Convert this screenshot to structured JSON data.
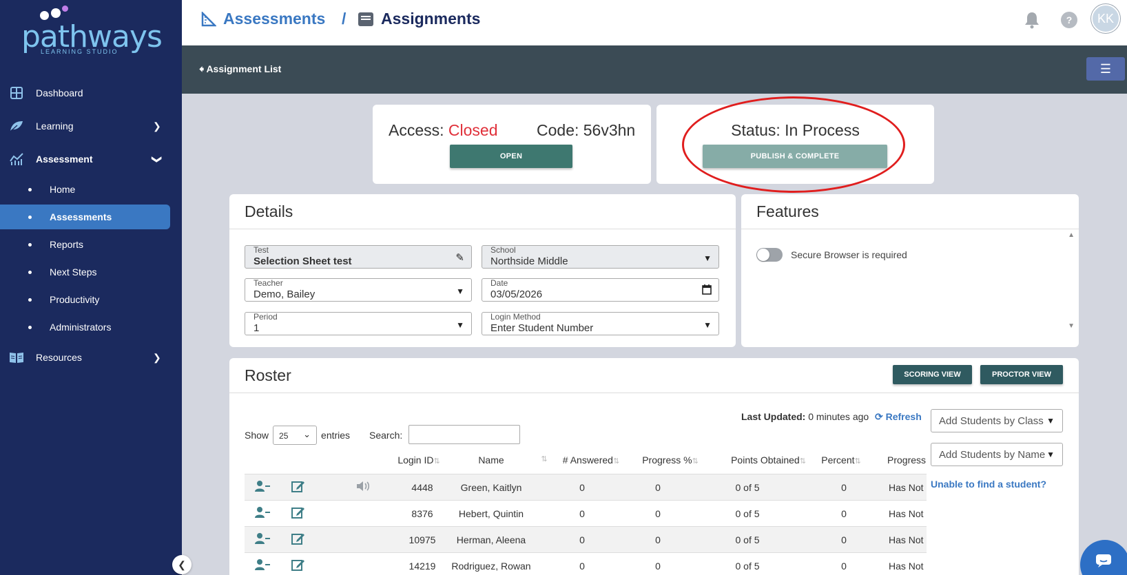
{
  "brand": {
    "word": "pathways",
    "sub": "LEARNING STUDIO"
  },
  "sidebar": {
    "items": [
      {
        "label": "Dashboard",
        "icon": "dashboard-icon"
      },
      {
        "label": "Learning",
        "icon": "leaf-icon"
      },
      {
        "label": "Assessment",
        "icon": "chart-icon"
      },
      {
        "label": "Resources",
        "icon": "book-icon"
      }
    ],
    "subitems": [
      {
        "label": "Home"
      },
      {
        "label": "Assessments",
        "active": true
      },
      {
        "label": "Reports"
      },
      {
        "label": "Next Steps"
      },
      {
        "label": "Productivity"
      },
      {
        "label": "Administrators"
      }
    ]
  },
  "header": {
    "crumb1": "Assessments",
    "separator": "/",
    "crumb2": "Assignments",
    "avatar_initials": "KK",
    "help": "?"
  },
  "subbar": {
    "back_label": "Assignment List"
  },
  "access": {
    "label": "Access:",
    "value": "Closed",
    "code_label": "Code:",
    "code_value": "56v3hn",
    "open_button": "OPEN"
  },
  "status": {
    "label": "Status:",
    "value": "In Process",
    "publish_button": "PUBLISH & COMPLETE"
  },
  "details": {
    "title": "Details",
    "test_label": "Test",
    "test_value": "Selection Sheet test",
    "school_label": "School",
    "school_value": "Northside Middle",
    "teacher_label": "Teacher",
    "teacher_value": "Demo, Bailey",
    "date_label": "Date",
    "date_value": "03/05/2026",
    "period_label": "Period",
    "period_value": "1",
    "login_label": "Login Method",
    "login_value": "Enter Student Number"
  },
  "features": {
    "title": "Features",
    "secure_browser_label": "Secure Browser is required",
    "secure_browser_on": false
  },
  "roster": {
    "title": "Roster",
    "scoring_view": "SCORING VIEW",
    "proctor_view": "PROCTOR VIEW",
    "last_updated_label": "Last Updated:",
    "last_updated_value": "0 minutes ago",
    "refresh": "Refresh",
    "add_by_class": "Add Students by Class",
    "add_by_name": "Add Students by Name",
    "unable": "Unable to find a student?",
    "show_label": "Show",
    "entries_value": "25",
    "entries_label": "entries",
    "search_label": "Search:",
    "search_value": "",
    "columns": [
      "Login ID",
      "Name",
      "# Answered",
      "Progress %",
      "Points Obtained",
      "Percent",
      "Progress"
    ],
    "rows": [
      {
        "login": "4448",
        "name": "Green, Kaitlyn",
        "answered": "0",
        "progress_pct": "0",
        "points": "0 of 5",
        "percent": "0",
        "progress": "Has Not Lo"
      },
      {
        "login": "8376",
        "name": "Hebert, Quintin",
        "answered": "0",
        "progress_pct": "0",
        "points": "0 of 5",
        "percent": "0",
        "progress": "Has Not Lo"
      },
      {
        "login": "10975",
        "name": "Herman, Aleena",
        "answered": "0",
        "progress_pct": "0",
        "points": "0 of 5",
        "percent": "0",
        "progress": "Has Not Lo"
      },
      {
        "login": "14219",
        "name": "Rodriguez, Rowan",
        "answered": "0",
        "progress_pct": "0",
        "points": "0 of 5",
        "percent": "0",
        "progress": "Has Not Lo"
      }
    ]
  },
  "colors": {
    "sidebar_bg": "#1b2a5e",
    "accent": "#3a78c2",
    "teal": "#3e7870",
    "closed_red": "#e0303a",
    "highlight_circle": "#e01e1e"
  }
}
